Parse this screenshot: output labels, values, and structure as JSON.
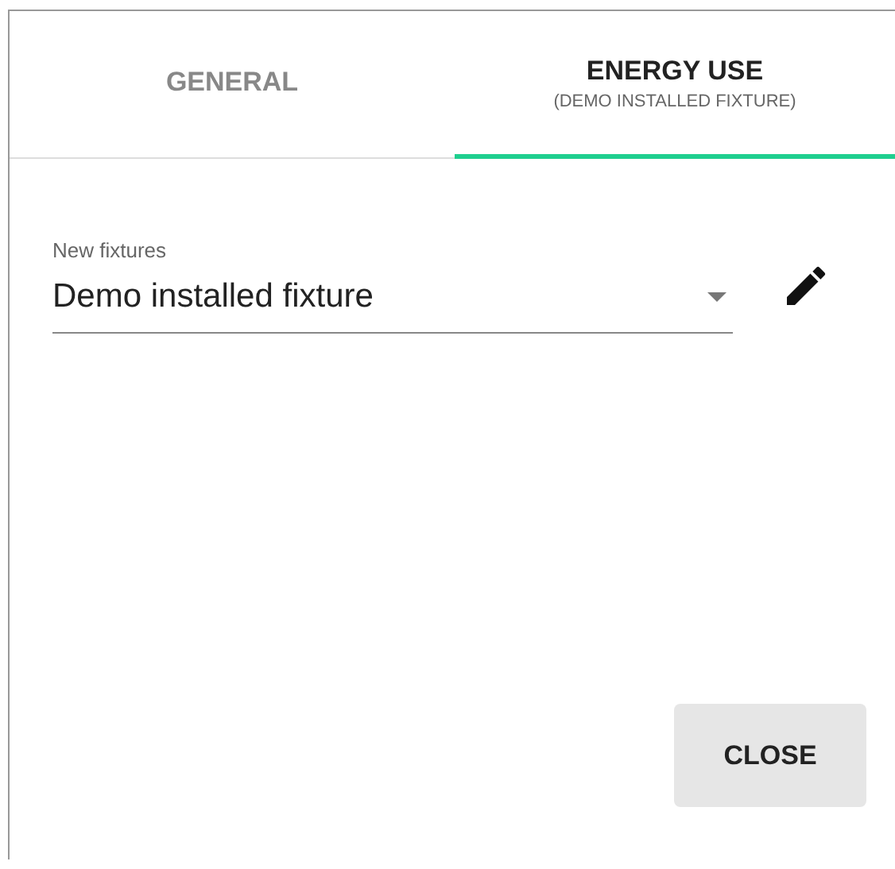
{
  "tabs": [
    {
      "label": "GENERAL",
      "selected": false
    },
    {
      "label": "ENERGY USE",
      "sublabel": "(DEMO INSTALLED FIXTURE)",
      "selected": true
    }
  ],
  "select": {
    "label": "New fixtures",
    "value": "Demo installed fixture"
  },
  "buttons": [
    "CLOSE"
  ]
}
